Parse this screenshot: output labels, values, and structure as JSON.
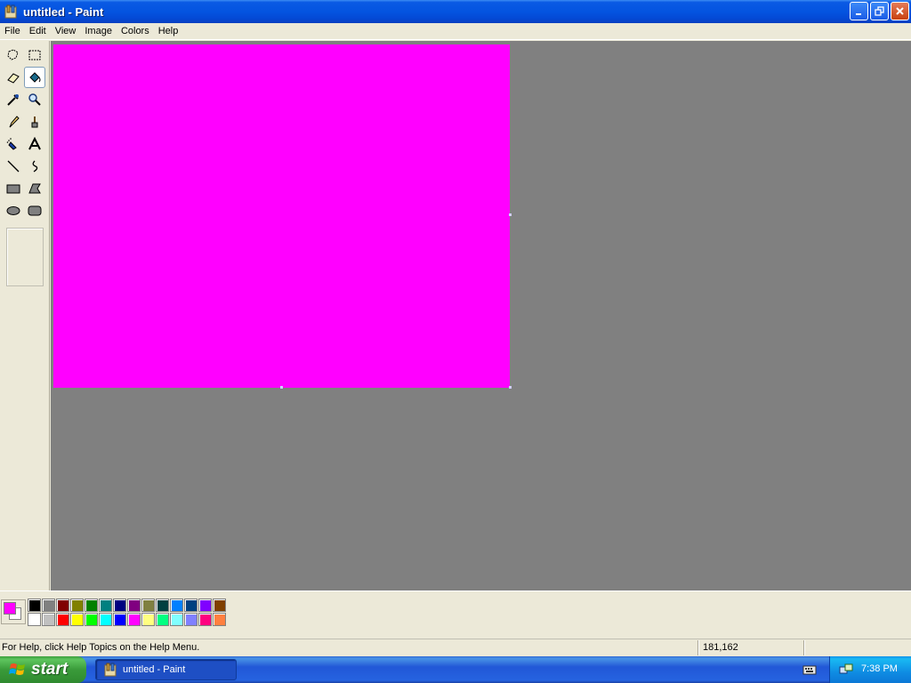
{
  "window": {
    "title": "untitled - Paint",
    "buttons": {
      "minimize": "minimize",
      "maximize": "restore",
      "close": "close"
    }
  },
  "menu": [
    {
      "label": "File"
    },
    {
      "label": "Edit"
    },
    {
      "label": "View"
    },
    {
      "label": "Image"
    },
    {
      "label": "Colors"
    },
    {
      "label": "Help"
    }
  ],
  "tools": [
    {
      "name": "free-form-select",
      "icon": "free-form-select-icon",
      "active": false
    },
    {
      "name": "select",
      "icon": "rect-select-icon",
      "active": false
    },
    {
      "name": "eraser",
      "icon": "eraser-icon",
      "active": false
    },
    {
      "name": "fill-with-color",
      "icon": "paint-bucket-icon",
      "active": true
    },
    {
      "name": "pick-color",
      "icon": "eyedropper-icon",
      "active": false
    },
    {
      "name": "magnifier",
      "icon": "magnifier-icon",
      "active": false
    },
    {
      "name": "pencil",
      "icon": "pencil-icon",
      "active": false
    },
    {
      "name": "brush",
      "icon": "brush-icon",
      "active": false
    },
    {
      "name": "airbrush",
      "icon": "airbrush-icon",
      "active": false
    },
    {
      "name": "text",
      "icon": "text-icon",
      "active": false
    },
    {
      "name": "line",
      "icon": "line-icon",
      "active": false
    },
    {
      "name": "curve",
      "icon": "curve-icon",
      "active": false
    },
    {
      "name": "rectangle",
      "icon": "rectangle-icon",
      "active": false
    },
    {
      "name": "polygon",
      "icon": "polygon-icon",
      "active": false
    },
    {
      "name": "ellipse",
      "icon": "ellipse-icon",
      "active": false
    },
    {
      "name": "rounded-rectangle",
      "icon": "rounded-rect-icon",
      "active": false
    }
  ],
  "canvas": {
    "fill_color": "#ff00ff"
  },
  "colors": {
    "foreground": "#ff00ff",
    "background": "#ffffff",
    "palette_top": [
      "#000000",
      "#808080",
      "#800000",
      "#808000",
      "#008000",
      "#008080",
      "#000080",
      "#800080",
      "#808040",
      "#004040",
      "#0080ff",
      "#004080",
      "#8000ff",
      "#804000"
    ],
    "palette_bottom": [
      "#ffffff",
      "#c0c0c0",
      "#ff0000",
      "#ffff00",
      "#00ff00",
      "#00ffff",
      "#0000ff",
      "#ff00ff",
      "#ffff80",
      "#00ff80",
      "#80ffff",
      "#8080ff",
      "#ff0080",
      "#ff8040"
    ]
  },
  "status": {
    "help_text": "For Help, click Help Topics on the Help Menu.",
    "coords": "181,162"
  },
  "taskbar": {
    "start_label": "start",
    "task_label": "untitled - Paint",
    "clock": "7:38 PM"
  },
  "ui_colors": {
    "workspace": "#808080",
    "face": "#ece9d8",
    "titlebar_blue": "#0454e0"
  }
}
